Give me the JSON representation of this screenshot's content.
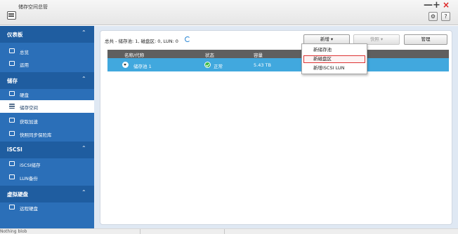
{
  "window": {
    "title": "储存空间总管",
    "minimize": "—",
    "maximize": "+",
    "close": "×",
    "settings_glyph": "⚙",
    "help_glyph": "?"
  },
  "sidebar": {
    "sections": [
      {
        "label": "仪表板",
        "items": [
          {
            "label": "总览",
            "icon": "overview-icon"
          },
          {
            "label": "运用",
            "icon": "usage-icon"
          }
        ]
      },
      {
        "label": "储存",
        "items": [
          {
            "label": "硬盘",
            "icon": "disk-icon"
          },
          {
            "label": "储存空间",
            "icon": "storage-space-icon",
            "active": true
          },
          {
            "label": "获取加速",
            "icon": "cache-acceleration-icon"
          },
          {
            "label": "快照同步保险库",
            "icon": "snapshot-vault-icon"
          }
        ]
      },
      {
        "label": "iSCSI",
        "items": [
          {
            "label": "iSCSI储存",
            "icon": "iscsi-storage-icon"
          },
          {
            "label": "LUN备份",
            "icon": "lun-backup-icon"
          }
        ]
      },
      {
        "label": "虚拟硬盘",
        "items": [
          {
            "label": "远程硬盘",
            "icon": "remote-disk-icon"
          }
        ]
      }
    ],
    "chevron": "⌃"
  },
  "toolbar": {
    "summary": "总共 - 储存池: 1, 磁盘区: 0, LUN: 0",
    "new_label": "新增 ▾",
    "snapshot_label": "快照 ▾",
    "manage_label": "管理"
  },
  "dropdown": {
    "items": [
      "新储存池",
      "新磁盘区",
      "新增iSCSI LUN"
    ],
    "highlighted": 1
  },
  "table": {
    "columns": [
      "名称/代称",
      "状态",
      "容量"
    ],
    "rows": [
      {
        "name": "储存池 1",
        "status": "正常",
        "capacity": "5.43 TB"
      }
    ]
  },
  "statusbar": {
    "text": "Nothing blob"
  },
  "colors": {
    "sidebar_bg": "#2b6fb8",
    "sidebar_header": "#1f5da0",
    "row_selected": "#41a8de",
    "table_header": "#5f5f5f",
    "status_ok": "#3dbb47",
    "close_red": "#d22222"
  }
}
